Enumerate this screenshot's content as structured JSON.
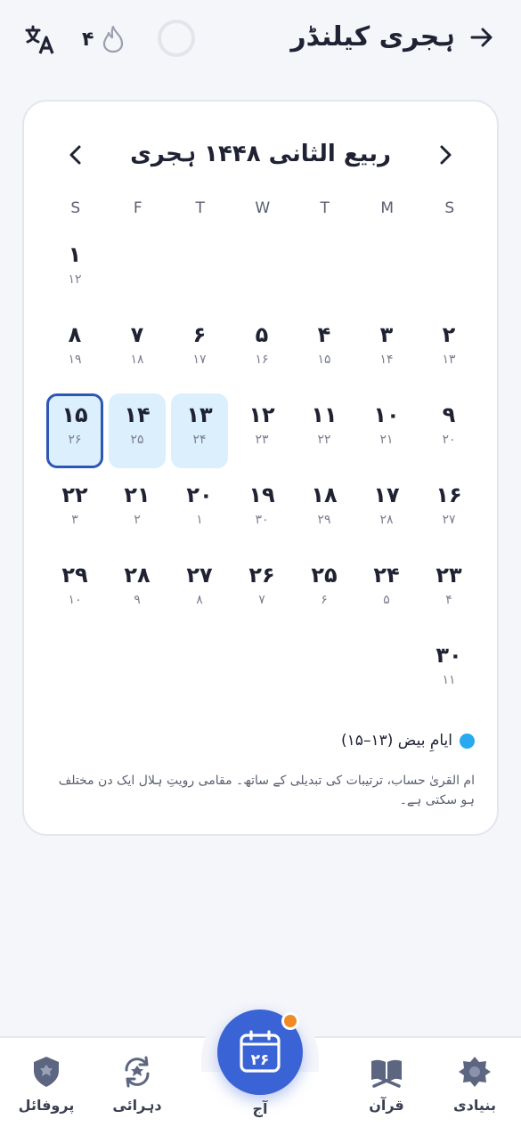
{
  "header": {
    "title": "ہجری کیلنڈر",
    "streak_count": "۴",
    "icons": [
      "translate-icon",
      "flame-icon",
      "progress-ring-icon",
      "back-arrow-icon"
    ]
  },
  "calendar": {
    "month_title": "ربیع الثانی ۱۴۴۸ ہجری",
    "weekdays": [
      "S",
      "F",
      "T",
      "W",
      "T",
      "M",
      "S"
    ],
    "rows": [
      [
        {
          "h": "۱",
          "g": "۱۲"
        },
        {
          "h": "",
          "g": ""
        },
        {
          "h": "",
          "g": ""
        },
        {
          "h": "",
          "g": ""
        },
        {
          "h": "",
          "g": ""
        },
        {
          "h": "",
          "g": ""
        },
        {
          "h": "",
          "g": ""
        }
      ],
      [
        {
          "h": "۸",
          "g": "۱۹"
        },
        {
          "h": "۷",
          "g": "۱۸"
        },
        {
          "h": "۶",
          "g": "۱۷"
        },
        {
          "h": "۵",
          "g": "۱۶"
        },
        {
          "h": "۴",
          "g": "۱۵"
        },
        {
          "h": "۳",
          "g": "۱۴"
        },
        {
          "h": "۲",
          "g": "۱۳"
        }
      ],
      [
        {
          "h": "۱۵",
          "g": "۲۶",
          "state": "today"
        },
        {
          "h": "۱۴",
          "g": "۲۵",
          "state": "white"
        },
        {
          "h": "۱۳",
          "g": "۲۴",
          "state": "white"
        },
        {
          "h": "۱۲",
          "g": "۲۳"
        },
        {
          "h": "۱۱",
          "g": "۲۲"
        },
        {
          "h": "۱۰",
          "g": "۲۱"
        },
        {
          "h": "۹",
          "g": "۲۰"
        }
      ],
      [
        {
          "h": "۲۲",
          "g": "۳"
        },
        {
          "h": "۲۱",
          "g": "۲"
        },
        {
          "h": "۲۰",
          "g": "۱"
        },
        {
          "h": "۱۹",
          "g": "۳۰"
        },
        {
          "h": "۱۸",
          "g": "۲۹"
        },
        {
          "h": "۱۷",
          "g": "۲۸"
        },
        {
          "h": "۱۶",
          "g": "۲۷"
        }
      ],
      [
        {
          "h": "۲۹",
          "g": "۱۰"
        },
        {
          "h": "۲۸",
          "g": "۹"
        },
        {
          "h": "۲۷",
          "g": "۸"
        },
        {
          "h": "۲۶",
          "g": "۷"
        },
        {
          "h": "۲۵",
          "g": "۶"
        },
        {
          "h": "۲۴",
          "g": "۵"
        },
        {
          "h": "۲۳",
          "g": "۴"
        }
      ],
      [
        {
          "h": "",
          "g": ""
        },
        {
          "h": "",
          "g": ""
        },
        {
          "h": "",
          "g": ""
        },
        {
          "h": "",
          "g": ""
        },
        {
          "h": "",
          "g": ""
        },
        {
          "h": "",
          "g": ""
        },
        {
          "h": "۳۰",
          "g": "۱۱"
        }
      ]
    ],
    "legend_label": "ایامِ بیض (۱۳–۱۵)",
    "note": "ام القریٰ حساب، ترتیبات کی تبدیلی کے ساتھ۔ مقامی رویتِ ہلال ایک دن مختلف ہو سکتی ہے۔"
  },
  "colors": {
    "accent": "#3a63d6",
    "today_border": "#2e56b5",
    "white_days_bg": "#dbeffd",
    "legend_dot": "#29a9f0",
    "notification_dot": "#f08a24"
  },
  "bottom_nav": {
    "items": [
      {
        "label": "بنیادی",
        "icon": "star-octagon-icon"
      },
      {
        "label": "قرآن",
        "icon": "quran-book-icon"
      },
      {
        "label": "آج",
        "icon": "calendar-icon",
        "date": "۲۶",
        "active": true
      },
      {
        "label": "دہرائی",
        "icon": "review-cycle-icon"
      },
      {
        "label": "پروفائل",
        "icon": "shield-profile-icon"
      }
    ]
  }
}
